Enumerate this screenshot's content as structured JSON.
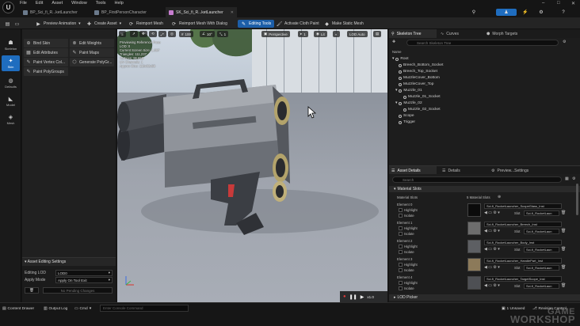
{
  "menubar": {
    "logo": "U",
    "items": [
      "File",
      "Edit",
      "Asset",
      "Window",
      "Tools",
      "Help"
    ],
    "window_controls": [
      "–",
      "□",
      "✕"
    ]
  },
  "tabs": [
    {
      "label": "BP_Sci_fi_R...ketLauncher",
      "active": false
    },
    {
      "label": "BP_FirstPersonCharacter",
      "active": false
    },
    {
      "label": "SK_Sci_fi_R...ketLauncher",
      "active": true
    }
  ],
  "toolbar": {
    "preview_animation": "Preview Animation",
    "create_asset": "Create Asset",
    "reimport_mesh": "Reimport Mesh",
    "reimport_mesh_dialog": "Reimport Mesh With Dialog",
    "editing_tools": "Editing Tools",
    "activate_cloth_paint": "Activate Cloth Paint",
    "make_static_mesh": "Make Static Mesh"
  },
  "modes": [
    {
      "label": "Skeleton",
      "active": false
    },
    {
      "label": "Skin",
      "active": true
    },
    {
      "label": "Defaults",
      "active": false
    },
    {
      "label": "Model",
      "active": false
    },
    {
      "label": "Mesh",
      "active": false
    }
  ],
  "tools": [
    {
      "label": "Bind Skin"
    },
    {
      "label": "Edit Weights"
    },
    {
      "label": "Edit Attributes"
    },
    {
      "label": "Paint Maps"
    },
    {
      "label": "Paint Vertex Col..."
    },
    {
      "label": "Generate PolyGr..."
    },
    {
      "label": "Paint PolyGroups"
    }
  ],
  "lod_panel": {
    "title": "Asset Editing Settings",
    "editing_lod_label": "Editing LOD",
    "editing_lod_value": "LOD0",
    "apply_mode_label": "Apply Mode",
    "apply_mode_value": "Apply On Tool Exit",
    "no_pending": "No Pending Changes"
  },
  "viewport": {
    "perspective": "Perspective",
    "lit": "Lit",
    "lod_auto": "LOD Auto",
    "zoom_values": [
      "100",
      "10°",
      "1"
    ],
    "stats": [
      "Previewing Reference Pose",
      "LOD: 0",
      "Current Screen Size: 1.097",
      "Triangles: 111,237",
      "Vertices: 96,658",
      "UV Channels: 1",
      "Approx Size: 119x32x55"
    ],
    "speed": "x1.0"
  },
  "skeleton_tabs": [
    {
      "label": "Skeleton Tree",
      "active": true
    },
    {
      "label": "Curves",
      "active": false
    },
    {
      "label": "Morph Targets",
      "active": false
    }
  ],
  "skeleton_tree": {
    "search_placeholder": "Search Skeleton Tree",
    "column": "Name",
    "nodes": [
      {
        "label": "Root",
        "depth": 0
      },
      {
        "label": "Breech_Bottom_Socket",
        "depth": 1
      },
      {
        "label": "Breech_Top_Socket",
        "depth": 1
      },
      {
        "label": "MuzzleCover_Bottom",
        "depth": 1
      },
      {
        "label": "MuzzleCover_Top",
        "depth": 1
      },
      {
        "label": "Muzzle_01",
        "depth": 1
      },
      {
        "label": "Muzzle_01_Socket",
        "depth": 2
      },
      {
        "label": "Muzzle_02",
        "depth": 1
      },
      {
        "label": "Muzzle_02_Socket",
        "depth": 2
      },
      {
        "label": "Scope",
        "depth": 1
      },
      {
        "label": "Trigger",
        "depth": 1
      }
    ]
  },
  "details_tabs": [
    {
      "label": "Asset Details",
      "active": true
    },
    {
      "label": "Details",
      "active": false
    },
    {
      "label": "Preview...Settings",
      "active": false
    }
  ],
  "details": {
    "search_placeholder": "Search",
    "material_slots_section": "Material Slots",
    "material_slots_label": "Material Slots",
    "material_slots_count": "5 Material Slots",
    "highlight": "Highlight",
    "isolate": "Isolate",
    "slot_label": "Slot",
    "elements": [
      {
        "label": "Element 0",
        "material": "Sci-fi_RocketLauncher_ScopeGlass_Inst",
        "slot": "Sci-fi_RocketLaun"
      },
      {
        "label": "Element 1",
        "material": "Sci-fi_RocketLauncher_Breech_Inst",
        "slot": "Sci-fi_RocketLaun"
      },
      {
        "label": "Element 2",
        "material": "Sci-fi_RocketLauncher_Body_Inst",
        "slot": "Sci-fi_RocketLaun"
      },
      {
        "label": "Element 3",
        "material": "Sci-fi_RocketLauncher_HandlePart_Inst",
        "slot": "Sci-fi_RocketLaun"
      },
      {
        "label": "Element 4",
        "material": "Sci-fi_RocketLauncher_TargetScope_Inst",
        "slot": "Sci-fi_RocketLaun"
      }
    ],
    "lod_picker": "LOD Picker"
  },
  "statusbar": {
    "content_drawer": "Content Drawer",
    "output_log": "Output Log",
    "cmd": "Cmd",
    "cmd_placeholder": "Enter Console Command",
    "unsaved": "1 Unsaved",
    "revision": "Revision Control"
  },
  "watermark": {
    "line1": "GAME",
    "line2": "WORKSHOP"
  },
  "colors": {
    "accent": "#1f6dbf",
    "panel": "#1d1d1d",
    "toolbar": "#242424"
  }
}
